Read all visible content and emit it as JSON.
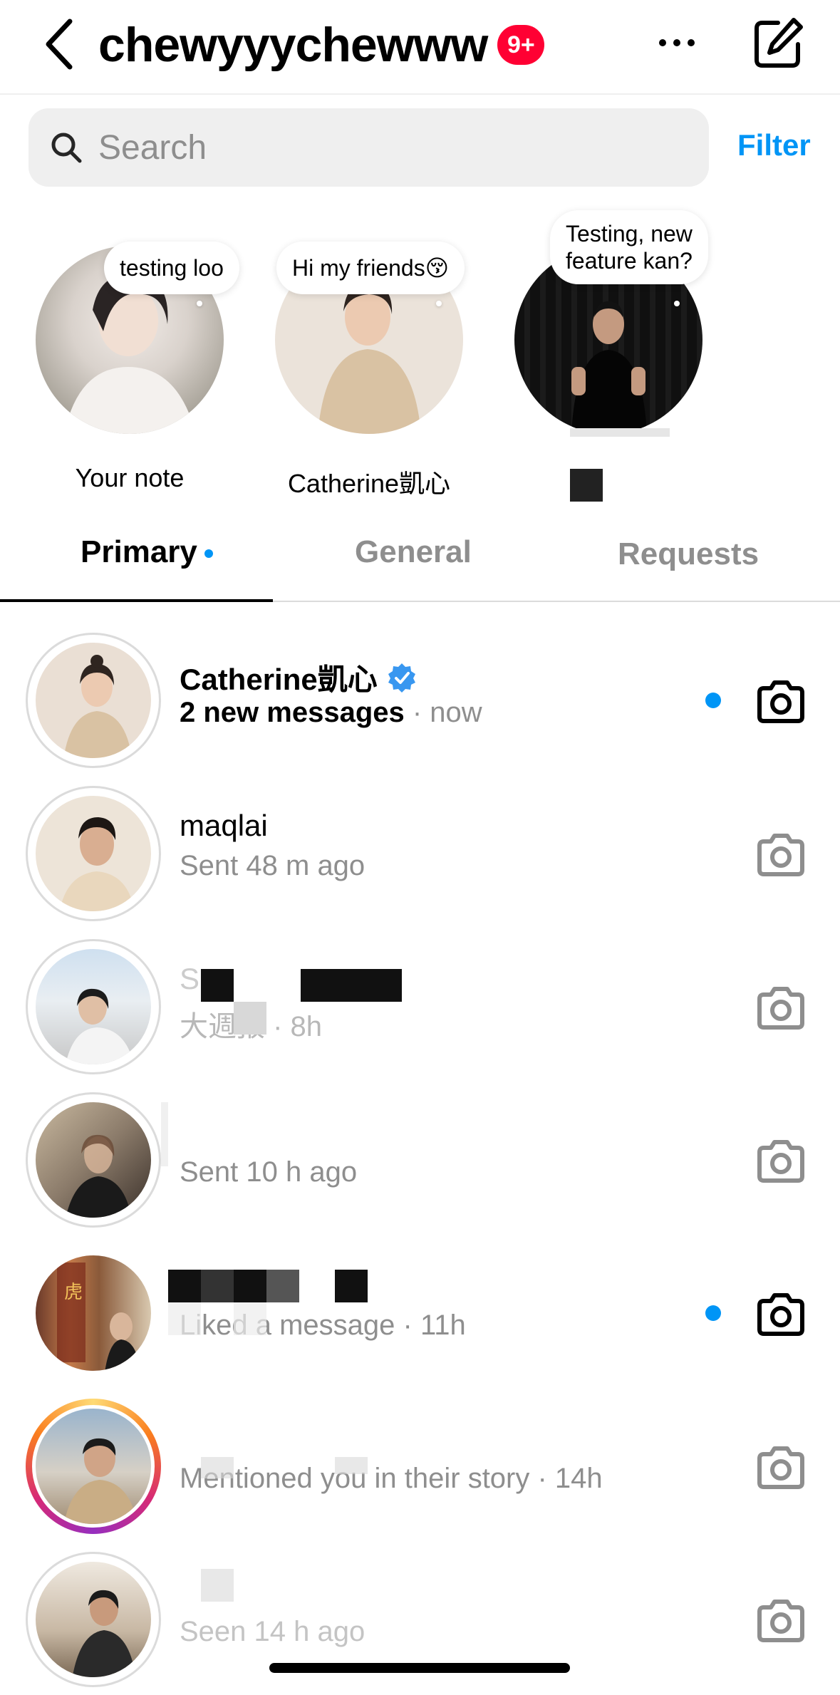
{
  "header": {
    "username": "chewyyychewww",
    "badge": "9+"
  },
  "search": {
    "placeholder": "Search"
  },
  "filter_label": "Filter",
  "notes": [
    {
      "bubble": "testing loo",
      "label": "Your note"
    },
    {
      "bubble": "Hi my friends😚",
      "label": "Catherine凱心"
    },
    {
      "bubble_line1": "Testing, new",
      "bubble_line2": "feature kan?",
      "label": ""
    }
  ],
  "tabs": [
    {
      "label": "Primary",
      "active": true,
      "has_dot": true
    },
    {
      "label": "General",
      "active": false
    },
    {
      "label": "Requests",
      "active": false
    }
  ],
  "threads": [
    {
      "name": "Catherine凱心",
      "verified": true,
      "sub_strong": "2 new messages",
      "sub_rest": " · now",
      "unread": true
    },
    {
      "name": "maqlai",
      "sub_rest": "Sent 48 m ago",
      "unread": false
    },
    {
      "name": "S",
      "sub_rest": "大週报 · 8h",
      "unread": false
    },
    {
      "name": "",
      "sub_rest": "Sent 10 h ago",
      "unread": false
    },
    {
      "name": "",
      "sub_rest": "Liked a message · 11h",
      "unread": true
    },
    {
      "name": "",
      "sub_rest": "Mentioned you in their story · 14h",
      "unread": false,
      "story": true
    },
    {
      "name": "",
      "sub_rest": "Seen 14 h ago",
      "unread": false
    }
  ],
  "colors": {
    "accent": "#0095f6",
    "badge": "#ff0033",
    "muted": "#8e8e8e"
  }
}
